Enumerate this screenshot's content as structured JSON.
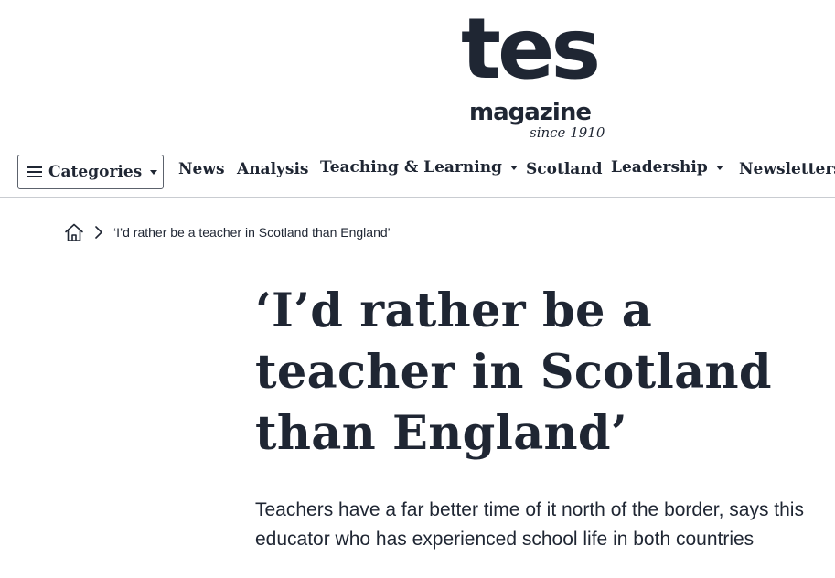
{
  "brand": {
    "logo_main": "tes",
    "logo_sub": "magazine",
    "logo_tagline": "since 1910",
    "text_color": "#1f2633"
  },
  "nav": {
    "categories_label": "Categories",
    "items": [
      {
        "label": "News",
        "has_dropdown": false
      },
      {
        "label": "Analysis",
        "has_dropdown": false
      },
      {
        "label": "Teaching & Learning",
        "has_dropdown": true
      },
      {
        "label": "Scotland",
        "has_dropdown": false
      },
      {
        "label": "Leadership",
        "has_dropdown": true
      },
      {
        "label": "Newsletters",
        "has_dropdown": false
      }
    ]
  },
  "breadcrumb": {
    "home_icon": "home-icon",
    "separator_icon": "chevron-right-icon",
    "current": "‘I’d rather be a teacher in Scotland than England’"
  },
  "article": {
    "headline": "‘I’d rather be a teacher in Scotland than England’",
    "standfirst": "Teachers have a far better time of it north of the border, says this educator who has experienced school life in both countries"
  }
}
